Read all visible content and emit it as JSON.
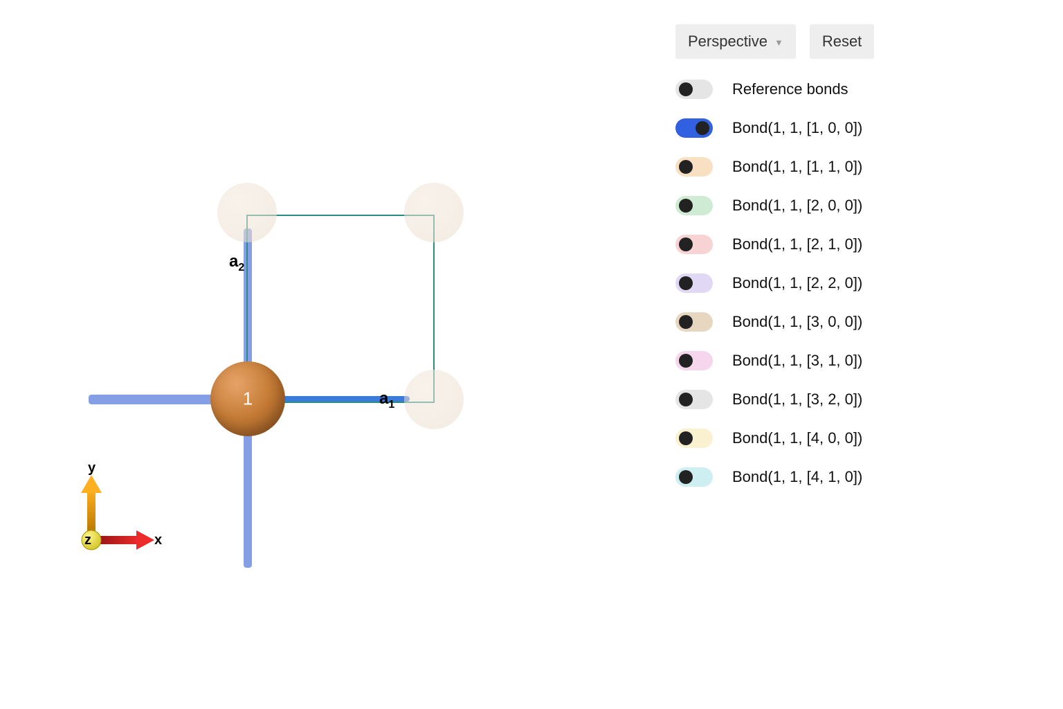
{
  "controls": {
    "view_mode": "Perspective",
    "reset_label": "Reset"
  },
  "legend": {
    "reference": {
      "label": "Reference bonds",
      "on": false,
      "bg": "#e5e5e5"
    },
    "bonds": [
      {
        "label": "Bond(1, 1, [1, 0, 0])",
        "on": true,
        "bg": "#3161e0"
      },
      {
        "label": "Bond(1, 1, [1, 1, 0])",
        "on": false,
        "bg": "#fae0c2"
      },
      {
        "label": "Bond(1, 1, [2, 0, 0])",
        "on": false,
        "bg": "#cfebd3"
      },
      {
        "label": "Bond(1, 1, [2, 1, 0])",
        "on": false,
        "bg": "#f7d3d3"
      },
      {
        "label": "Bond(1, 1, [2, 2, 0])",
        "on": false,
        "bg": "#e0d8f5"
      },
      {
        "label": "Bond(1, 1, [3, 0, 0])",
        "on": false,
        "bg": "#e7d6c0"
      },
      {
        "label": "Bond(1, 1, [3, 1, 0])",
        "on": false,
        "bg": "#f5d6ec"
      },
      {
        "label": "Bond(1, 1, [3, 2, 0])",
        "on": false,
        "bg": "#e5e5e5"
      },
      {
        "label": "Bond(1, 1, [4, 0, 0])",
        "on": false,
        "bg": "#f9f1cf"
      },
      {
        "label": "Bond(1, 1, [4, 1, 0])",
        "on": false,
        "bg": "#cdeff2"
      }
    ]
  },
  "scene": {
    "atom_label": "1",
    "axis_labels": {
      "a1": "a",
      "a1_sub": "1",
      "a2": "a",
      "a2_sub": "2"
    }
  },
  "compass": {
    "x": "x",
    "y": "y",
    "z": "z"
  }
}
